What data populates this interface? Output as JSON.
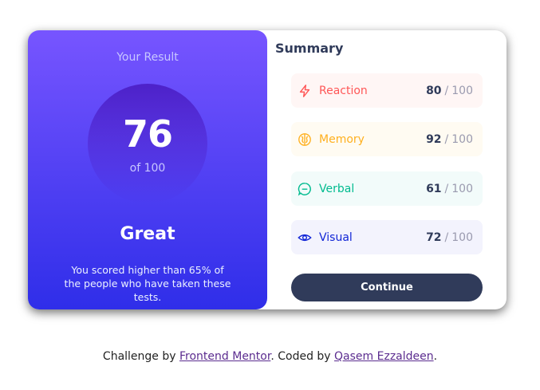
{
  "result": {
    "title": "Your Result",
    "score": "76",
    "score_of": "of 100",
    "rating": "Great",
    "description": "You scored higher than 65% of the people who have taken these tests."
  },
  "summary": {
    "title": "Summary",
    "separator": "/",
    "items": [
      {
        "label": "Reaction",
        "score": "80",
        "max": "100",
        "icon": "lightning-icon",
        "color": "#ff5757"
      },
      {
        "label": "Memory",
        "score": "92",
        "max": "100",
        "icon": "brain-icon",
        "color": "#ffb01f"
      },
      {
        "label": "Verbal",
        "score": "61",
        "max": "100",
        "icon": "chat-bubble-icon",
        "color": "#00bb8f"
      },
      {
        "label": "Visual",
        "score": "72",
        "max": "100",
        "icon": "eye-icon",
        "color": "#1125d6"
      }
    ],
    "continue_label": "Continue"
  },
  "footer": {
    "prefix": "Challenge by ",
    "link1": "Frontend Mentor",
    "middle": ". Coded by ",
    "link2": "Qasem Ezzaldeen",
    "suffix": "."
  }
}
